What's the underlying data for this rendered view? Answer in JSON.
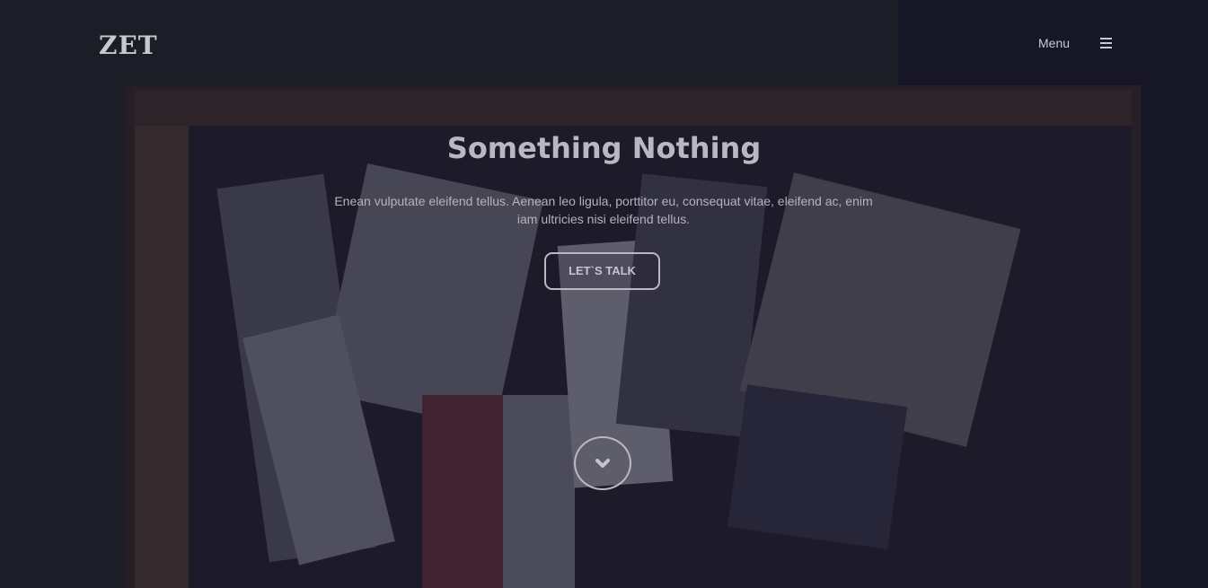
{
  "header": {
    "logo_text": "ZET",
    "menu_label": "Menu",
    "menu_icon": "hamburger-icon"
  },
  "hero": {
    "title": "Something Nothing",
    "description": "Enean vulputate eleifend tellus. Aenean leo ligula, porttitor eu, consequat vitae, eleifend ac, enim iam ultricies nisi eleifend tellus.",
    "cta_label": "LET`S TALK",
    "scroll_icon": "chevron-down-icon"
  },
  "colors": {
    "overlay": "#16142a",
    "text": "#b9b8c2",
    "border": "#b9b8c4"
  }
}
